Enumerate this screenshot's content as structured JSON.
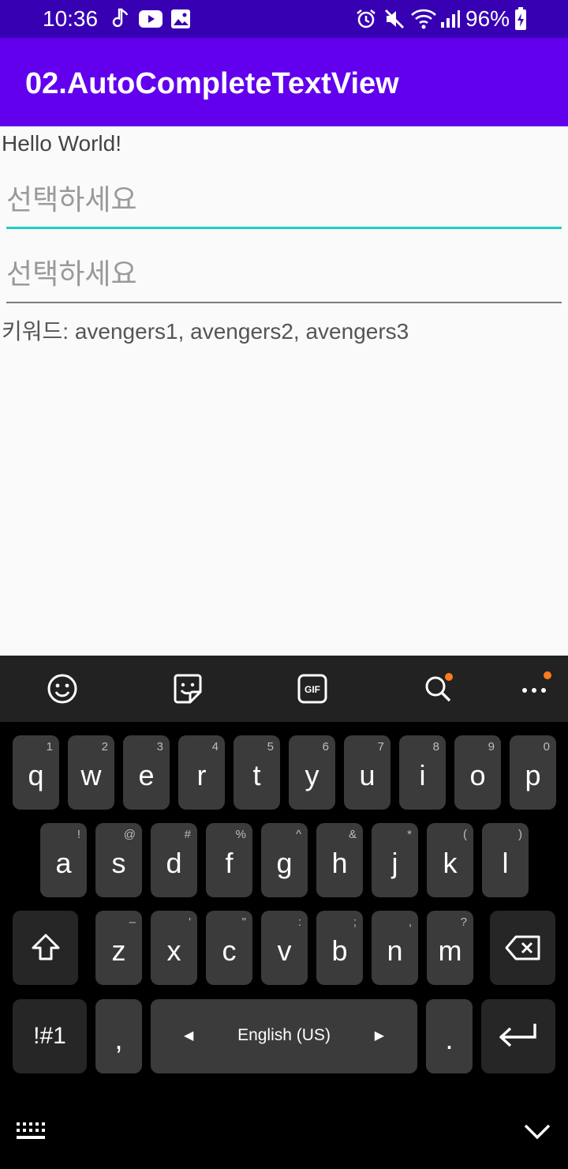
{
  "status_bar": {
    "time": "10:36",
    "battery": "96%",
    "icons": [
      "music-note-icon",
      "youtube-icon",
      "gallery-icon",
      "alarm-icon",
      "mute-icon",
      "wifi-icon",
      "signal-icon",
      "battery-icon"
    ]
  },
  "app_bar": {
    "title": "02.AutoCompleteTextView",
    "color": "#6200ee"
  },
  "main": {
    "hello_text": "Hello World!",
    "field1_placeholder": "선택하세요",
    "field2_placeholder": "선택하세요",
    "keywords": "키워드: avengers1, avengers2, avengers3"
  },
  "keyboard": {
    "toolbar_icons": [
      "emoji-icon",
      "sticker-icon",
      "gif-icon",
      "search-icon",
      "more-icon"
    ],
    "row1": [
      {
        "k": "q",
        "s": "1"
      },
      {
        "k": "w",
        "s": "2"
      },
      {
        "k": "e",
        "s": "3"
      },
      {
        "k": "r",
        "s": "4"
      },
      {
        "k": "t",
        "s": "5"
      },
      {
        "k": "y",
        "s": "6"
      },
      {
        "k": "u",
        "s": "7"
      },
      {
        "k": "i",
        "s": "8"
      },
      {
        "k": "o",
        "s": "9"
      },
      {
        "k": "p",
        "s": "0"
      }
    ],
    "row2": [
      {
        "k": "a",
        "s": "!"
      },
      {
        "k": "s",
        "s": "@"
      },
      {
        "k": "d",
        "s": "#"
      },
      {
        "k": "f",
        "s": "%"
      },
      {
        "k": "g",
        "s": "^"
      },
      {
        "k": "h",
        "s": "&"
      },
      {
        "k": "j",
        "s": "*"
      },
      {
        "k": "k",
        "s": "("
      },
      {
        "k": "l",
        "s": ")"
      }
    ],
    "row3": [
      {
        "k": "z",
        "s": "–"
      },
      {
        "k": "x",
        "s": "'"
      },
      {
        "k": "c",
        "s": "\""
      },
      {
        "k": "v",
        "s": ":"
      },
      {
        "k": "b",
        "s": ";"
      },
      {
        "k": "n",
        "s": ","
      },
      {
        "k": "m",
        "s": "?"
      }
    ],
    "symbols_label": "!#1",
    "comma_label": ",",
    "space_label": "English (US)",
    "period_label": "."
  }
}
